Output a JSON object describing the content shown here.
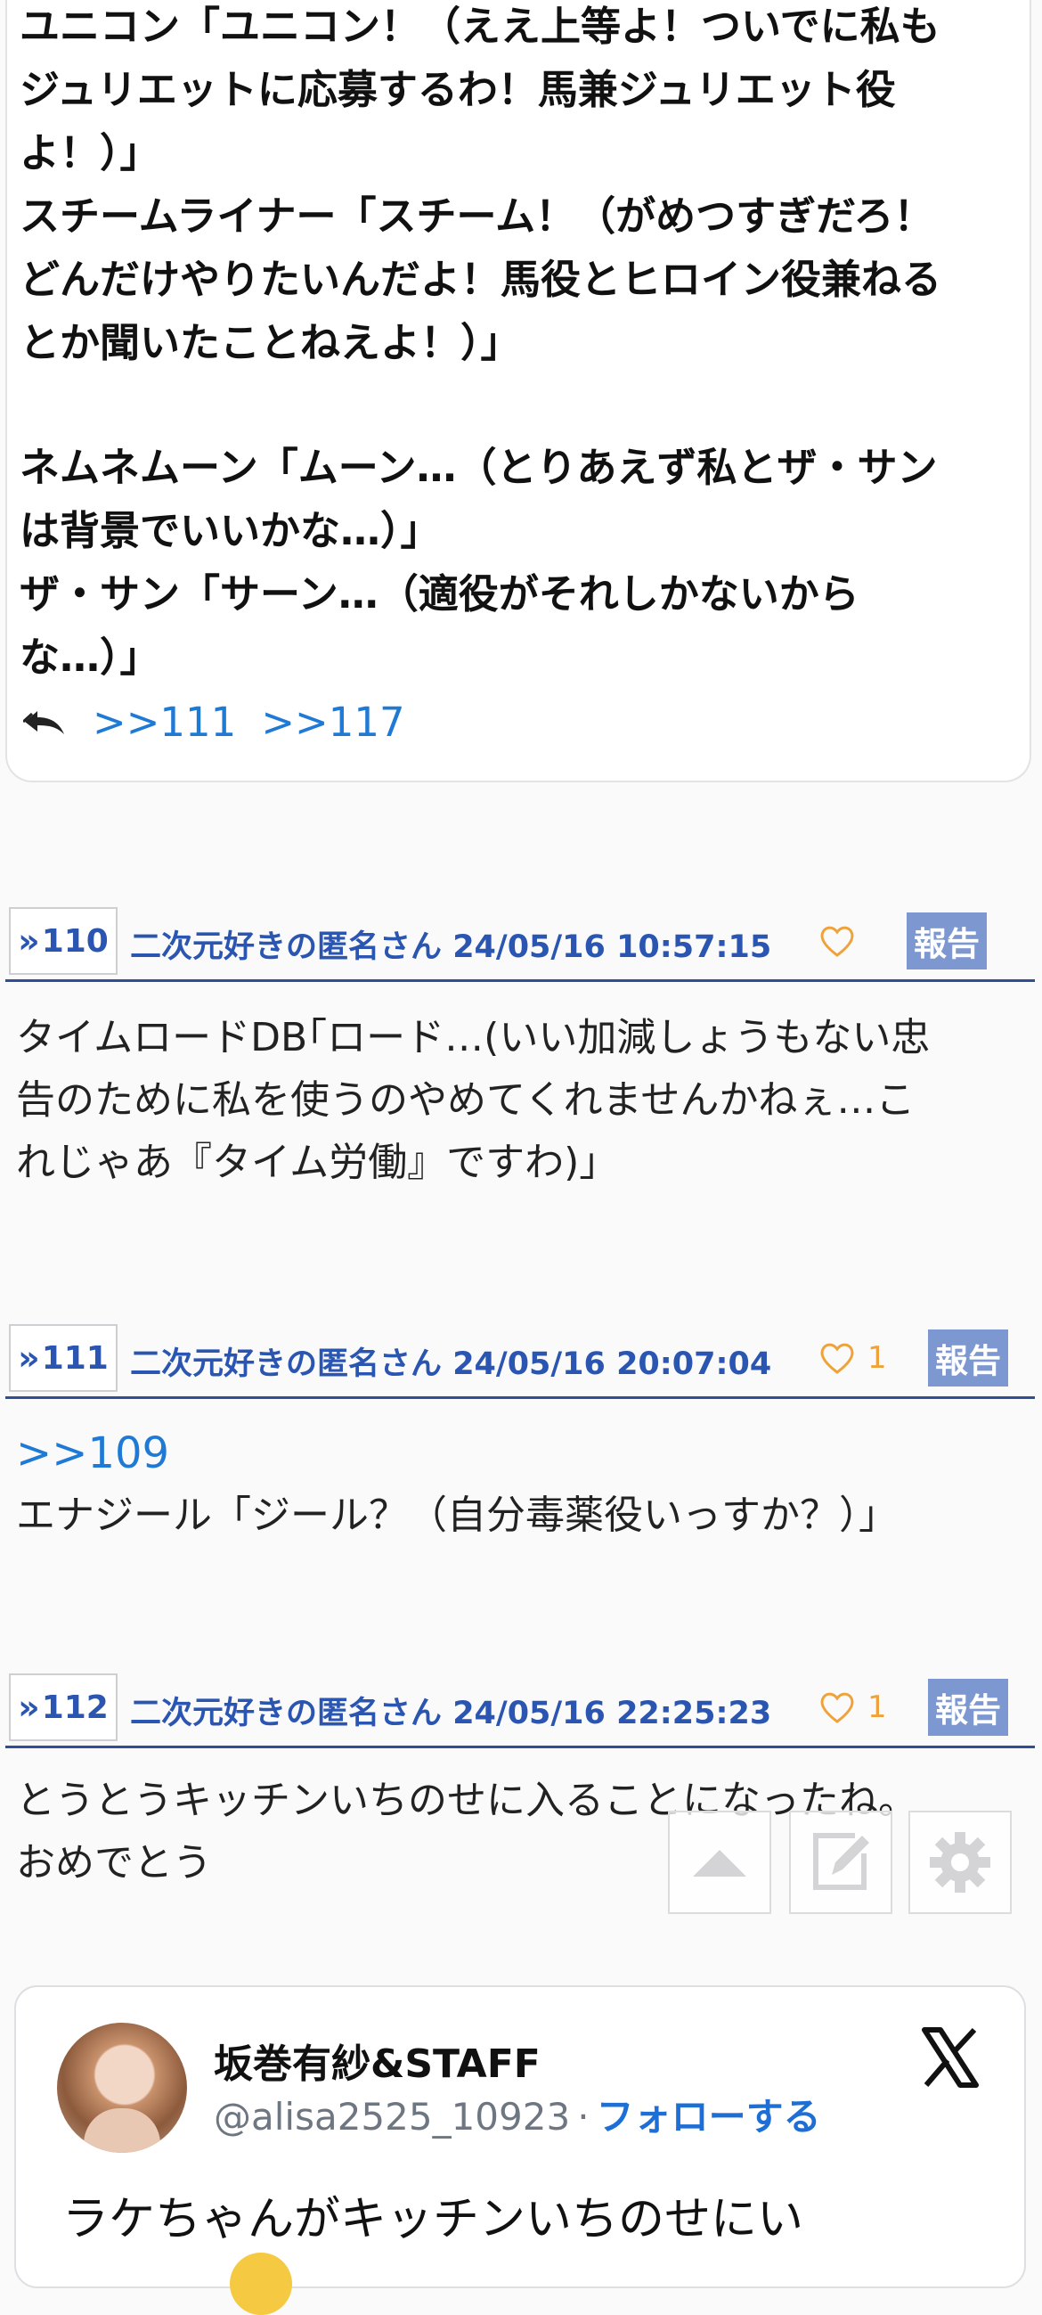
{
  "top_post": {
    "lines": [
      "ユニコン「ユニコン！（ええ上等よ！ついでに私も",
      "ジュリエットに応募するわ！馬兼ジュリエット役",
      "よ！）」",
      "スチームライナー「スチーム！（がめつすぎだろ！",
      "どんだけやりたいんだよ！馬役とヒロイン役兼ねる",
      "とか聞いたことねえよ！）」",
      "",
      "ネムネムーン「ムーン…（とりあえず私とザ・サン",
      "は背景でいいかな…）」",
      "ザ・サン「サーン…（適役がそれしかないから",
      "な…）」"
    ],
    "reply_links": [
      ">>111",
      ">>117"
    ]
  },
  "posts": [
    {
      "number": "110",
      "poster": "二次元好きの匿名さん",
      "datetime": "24/05/16 10:57:15",
      "likes": "",
      "report_label": "報告",
      "body_lines": [
        "タイムロードDB｢ロード…(いい加減しょうもない忠",
        "告のために私を使うのやめてくれませんかねぇ…こ",
        "れじゃあ『タイム労働』ですわ)｣"
      ]
    },
    {
      "number": "111",
      "poster": "二次元好きの匿名さん",
      "datetime": "24/05/16 20:07:04",
      "likes": "1",
      "report_label": "報告",
      "reply_ref": ">>109",
      "body_lines": [
        "エナジール「ジール？（自分毒薬役いっすか？）」"
      ]
    },
    {
      "number": "112",
      "poster": "二次元好きの匿名さん",
      "datetime": "24/05/16 22:25:23",
      "likes": "1",
      "report_label": "報告",
      "body_lines": [
        "とうとうキッチンいちのせに入ることになったね。",
        "おめでとう"
      ]
    }
  ],
  "floating_buttons": [
    "arrow-up-icon",
    "edit-icon",
    "gear-icon"
  ],
  "embed": {
    "name": "坂巻有紗&STAFF",
    "handle": "@alisa2525_10923",
    "separator": "·",
    "follow_label": "フォローする",
    "text": "ラケちゃんがキッチンいちのせにい"
  },
  "colors": {
    "link": "#1f7ad6",
    "header_text": "#2a55b0",
    "header_rule": "#2e4e96",
    "report_bg": "#7d98d0",
    "like": "#f0a23a"
  }
}
